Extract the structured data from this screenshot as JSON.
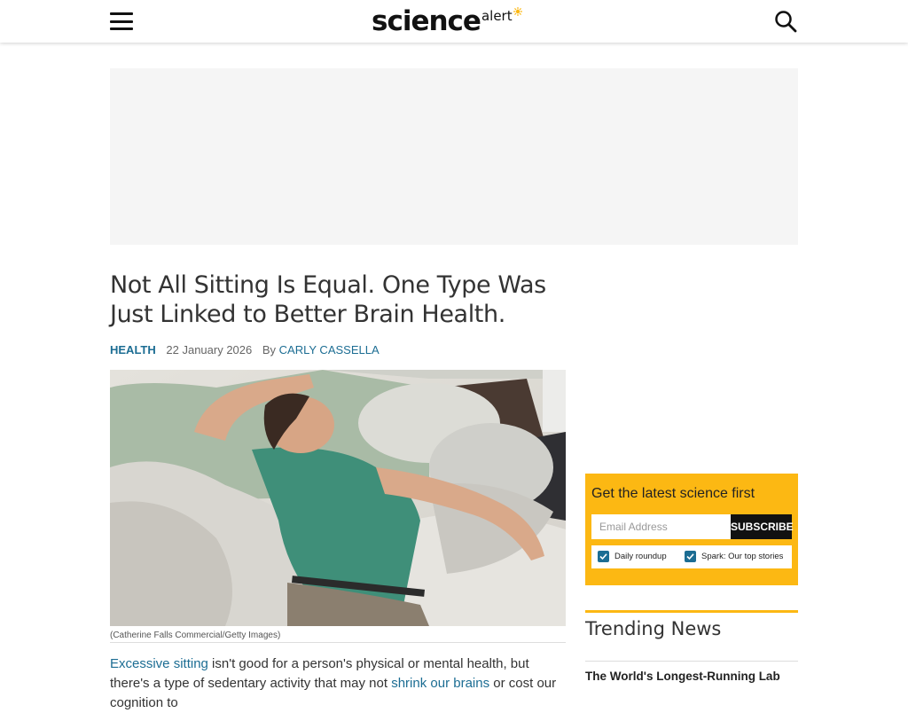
{
  "header": {
    "logo_main": "science",
    "logo_sub": "alert",
    "menu_icon": "hamburger-menu-icon",
    "search_icon": "search-icon",
    "logo_accent_color": "#fcb813"
  },
  "article": {
    "headline": "Not All Sitting Is Equal. One Type Was Just Linked to Better Brain Health.",
    "category": "HEALTH",
    "date": "22 January 2026",
    "by_label": "By",
    "author": "CARLY CASSELLA",
    "image_caption": "(Catherine Falls Commercial/Getty Images)",
    "body": {
      "link1": "Excessive sitting",
      "text1": " isn't good for a person's physical or mental health, but there's a type of sedentary activity that may not ",
      "link2": "shrink our brains",
      "text2": " or cost our cognition to"
    }
  },
  "newsletter": {
    "title": "Get the latest science first",
    "email_placeholder": "Email Address",
    "subscribe_label": "SUBSCRIBE",
    "options": [
      {
        "label": "Daily roundup",
        "checked": true
      },
      {
        "label": "Spark: Our top stories",
        "checked": true
      }
    ],
    "background_color": "#fcb813"
  },
  "trending": {
    "title": "Trending News",
    "items": [
      "The World's Longest-Running Lab"
    ]
  },
  "colors": {
    "link": "#1c6d93",
    "accent": "#fcb813"
  }
}
